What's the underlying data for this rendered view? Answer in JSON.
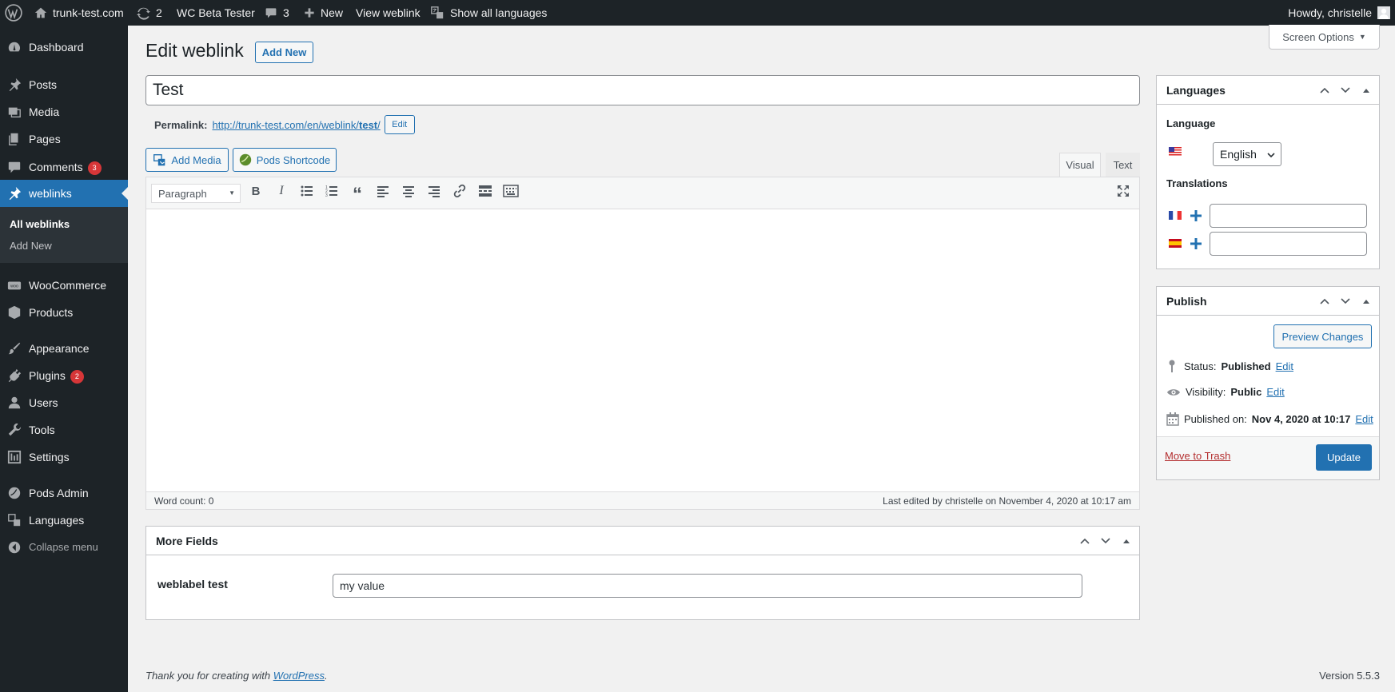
{
  "adminbar": {
    "site": "trunk-test.com",
    "updates": "2",
    "plugin": "WC Beta Tester",
    "comments": "3",
    "new": "New",
    "view": "View weblink",
    "languages": "Show all languages",
    "howdy": "Howdy, christelle"
  },
  "sidebar": {
    "dashboard": "Dashboard",
    "posts": "Posts",
    "media": "Media",
    "pages": "Pages",
    "comments": "Comments",
    "comments_count": "3",
    "weblinks": "weblinks",
    "all_weblinks": "All weblinks",
    "add_new": "Add New",
    "woocommerce": "WooCommerce",
    "products": "Products",
    "appearance": "Appearance",
    "plugins": "Plugins",
    "plugins_count": "2",
    "users": "Users",
    "tools": "Tools",
    "settings": "Settings",
    "pods_admin": "Pods Admin",
    "languages": "Languages",
    "collapse": "Collapse menu"
  },
  "page": {
    "screen_options": "Screen Options",
    "title": "Edit weblink",
    "add_new": "Add New",
    "post_title": "Test",
    "permalink_label": "Permalink:",
    "permalink_base": "http://trunk-test.com/en/weblink/",
    "permalink_slug": "test",
    "permalink_end": "/",
    "permalink_edit": "Edit"
  },
  "editor": {
    "add_media": "Add Media",
    "pods_shortcode": "Pods Shortcode",
    "tab_visual": "Visual",
    "tab_text": "Text",
    "format": "Paragraph",
    "word_count": "Word count: 0",
    "last_edited": "Last edited by christelle on November 4, 2020 at 10:17 am"
  },
  "more_fields": {
    "title": "More Fields",
    "field_label": "weblabel test",
    "field_value": "my value"
  },
  "languages_box": {
    "title": "Languages",
    "language_label": "Language",
    "language_value": "English",
    "translations_label": "Translations"
  },
  "publish": {
    "title": "Publish",
    "preview": "Preview Changes",
    "status_label": "Status:",
    "status_value": "Published",
    "visibility_label": "Visibility:",
    "visibility_value": "Public",
    "published_label": "Published on:",
    "published_value": "Nov 4, 2020 at 10:17",
    "edit": "Edit",
    "trash": "Move to Trash",
    "update": "Update"
  },
  "footer": {
    "thanks": "Thank you for creating with ",
    "wp": "WordPress",
    "dot": ".",
    "version": "Version 5.5.3"
  },
  "colors": {
    "primary": "#2271b1",
    "adminbar": "#1d2327",
    "badge": "#d63638",
    "trash": "#b32d2e"
  }
}
